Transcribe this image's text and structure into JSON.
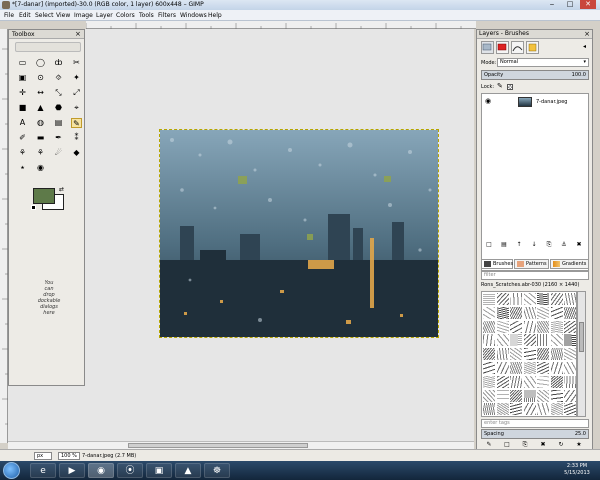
{
  "window": {
    "title": "*[7-danar] (imported)-30.0 (RGB color, 1 layer) 600x448 – GIMP",
    "minimize": "‒",
    "maximize": "□",
    "close": "✕"
  },
  "menu": [
    "File",
    "Edit",
    "Select",
    "View",
    "Image",
    "Layer",
    "Colors",
    "Tools",
    "Filters",
    "Windows",
    "Help"
  ],
  "toolbox": {
    "title": "Toolbox",
    "tools": [
      "▭",
      "◯",
      "ȸ",
      "✂",
      "▣",
      "⊙",
      "⯑",
      "✦",
      "✛",
      "↔",
      "⤡",
      "⤢",
      "■",
      "▲",
      "⬣",
      "⌖",
      "A",
      "◍",
      "▤",
      "✎",
      "✐",
      "▬",
      "✒",
      "⁑",
      "⚘",
      "⚘",
      "☄",
      "◆",
      "⭑",
      "◉",
      "",
      ""
    ],
    "selected_index": 19,
    "drop_hint": [
      "You",
      "can",
      "drop",
      "dockable",
      "dialogs",
      "here"
    ],
    "fg_color": "#5e7a49",
    "bg_color": "#ffffff"
  },
  "layers": {
    "dock_title": "Layers - Brushes",
    "mode_label": "Mode:",
    "mode_value": "Normal",
    "opacity_label": "Opacity",
    "opacity_value": "100.0",
    "lock_label": "Lock:",
    "layer_name": "7-danar.jpeg",
    "action_icons": [
      "□",
      "▤",
      "↑",
      "↓",
      "⎘",
      "⚓",
      "✖"
    ]
  },
  "brushes": {
    "tabs": [
      "Brushes",
      "Patterns",
      "Gradients"
    ],
    "filter_placeholder": "filter",
    "brush_name": "Rons_Scratches.abr-030 (2160 × 1440)",
    "tags_placeholder": "enter tags",
    "spacing_label": "Spacing",
    "spacing_value": "25.0",
    "action_icons": [
      "✎",
      "□",
      "⎘",
      "✖",
      "↻",
      "★"
    ]
  },
  "status": {
    "unit": "px",
    "zoom": "100 %",
    "file_info": "7-danar.jpeg (2.7 MB)"
  },
  "taskbar": {
    "apps": [
      "e",
      "▶",
      "◉",
      "⦿",
      "▣",
      "▲",
      "☸"
    ],
    "active_index": 2,
    "time": "2:33 PM",
    "date": "5/15/2013"
  }
}
